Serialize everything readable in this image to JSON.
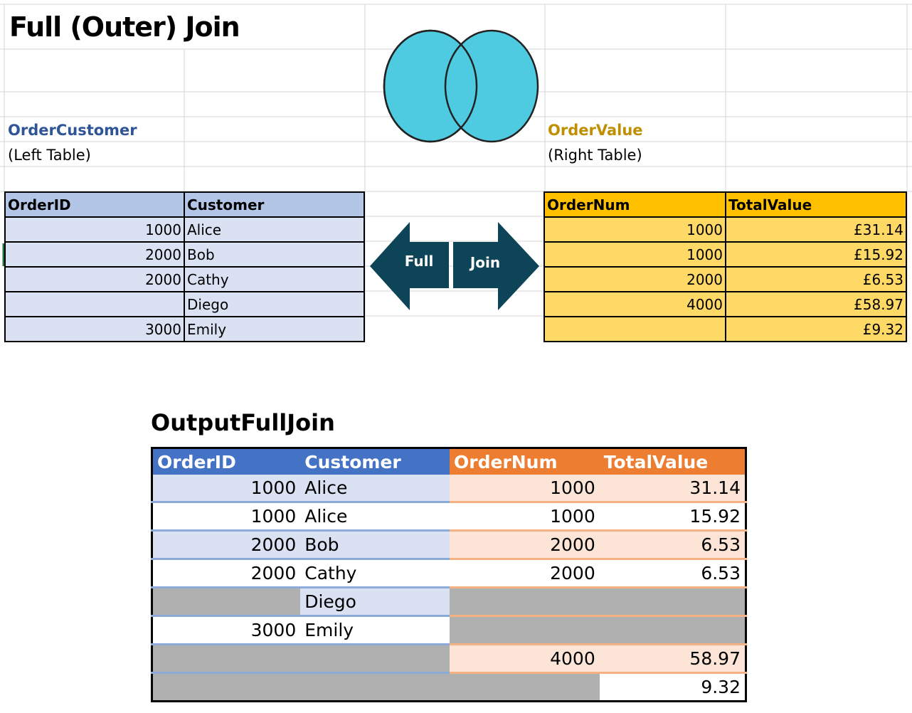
{
  "title": "Full (Outer) Join",
  "left": {
    "name": "OrderCustomer",
    "role": "(Left Table)",
    "headers": [
      "OrderID",
      "Customer"
    ],
    "rows": [
      {
        "id": "1000",
        "customer": "Alice"
      },
      {
        "id": "2000",
        "customer": "Bob"
      },
      {
        "id": "2000",
        "customer": "Cathy"
      },
      {
        "id": "",
        "customer": "Diego"
      },
      {
        "id": "3000",
        "customer": "Emily"
      }
    ]
  },
  "right": {
    "name": "OrderValue",
    "role": "(Right Table)",
    "headers": [
      "OrderNum",
      "TotalValue"
    ],
    "rows": [
      {
        "num": "1000",
        "value": "£31.14"
      },
      {
        "num": "1000",
        "value": "£15.92"
      },
      {
        "num": "2000",
        "value": "£6.53"
      },
      {
        "num": "4000",
        "value": "£58.97"
      },
      {
        "num": "",
        "value": "£9.32"
      }
    ]
  },
  "arrows": {
    "left_label": "Full",
    "right_label": "Join"
  },
  "output": {
    "name": "OutputFullJoin",
    "headers": [
      "OrderID",
      "Customer",
      "OrderNum",
      "TotalValue"
    ],
    "rows": [
      {
        "id": "1000",
        "customer": "Alice",
        "num": "1000",
        "value": "31.14"
      },
      {
        "id": "1000",
        "customer": "Alice",
        "num": "1000",
        "value": "15.92"
      },
      {
        "id": "2000",
        "customer": "Bob",
        "num": "2000",
        "value": "6.53"
      },
      {
        "id": "2000",
        "customer": "Cathy",
        "num": "2000",
        "value": "6.53"
      },
      {
        "id": "",
        "customer": "Diego",
        "num": "",
        "value": ""
      },
      {
        "id": "3000",
        "customer": "Emily",
        "num": "",
        "value": ""
      },
      {
        "id": "",
        "customer": "",
        "num": "4000",
        "value": "58.97"
      },
      {
        "id": "",
        "customer": "",
        "num": "",
        "value": "9.32"
      }
    ]
  },
  "colors": {
    "venn_fill": "#4ecbe0",
    "arrow_fill": "#0d4457",
    "left_header": "#b4c6e7",
    "right_header": "#ffc000",
    "output_left_header": "#4472c4",
    "output_right_header": "#ed7d31"
  }
}
